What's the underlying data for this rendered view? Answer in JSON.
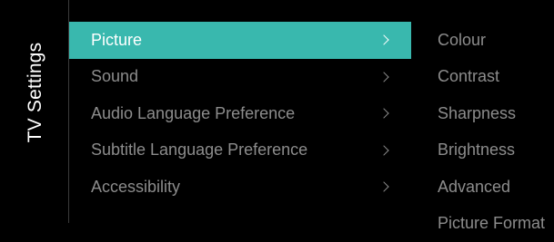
{
  "screen_title": "TV Settings",
  "menu": {
    "items": [
      {
        "label": "Picture",
        "selected": true
      },
      {
        "label": "Sound",
        "selected": false
      },
      {
        "label": "Audio Language Preference",
        "selected": false
      },
      {
        "label": "Subtitle Language Preference",
        "selected": false
      },
      {
        "label": "Accessibility",
        "selected": false
      }
    ],
    "chevron_icon": "chevron-right-icon"
  },
  "submenu": {
    "items": [
      {
        "label": "Colour"
      },
      {
        "label": "Contrast"
      },
      {
        "label": "Sharpness"
      },
      {
        "label": "Brightness"
      },
      {
        "label": "Advanced"
      },
      {
        "label": "Picture Format"
      }
    ]
  },
  "colors": {
    "background": "#000000",
    "accent": "#39b8ae",
    "selected_text": "#ffffff",
    "dim_text": "#8c8c8c",
    "divider": "#3a3a3a"
  }
}
